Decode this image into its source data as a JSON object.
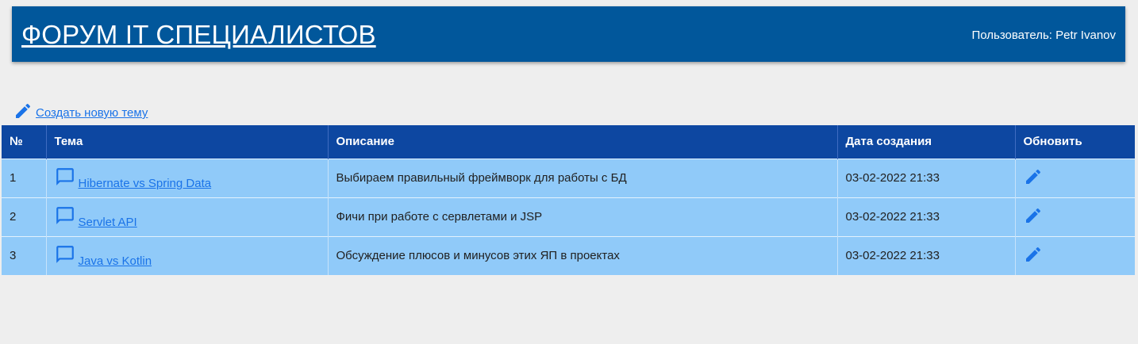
{
  "header": {
    "title": "ФОРУМ IT СПЕЦИАЛИСТОВ",
    "user_text": "Пользователь: Petr Ivanov"
  },
  "actions": {
    "create_topic_label": "Создать новую тему"
  },
  "table": {
    "columns": [
      "№",
      "Тема",
      "Описание",
      "Дата создания",
      "Обновить"
    ],
    "rows": [
      {
        "num": "1",
        "topic": "Hibernate vs Spring Data",
        "description": "Выбираем правильный фреймворк для работы с БД",
        "date": "03-02-2022 21:33"
      },
      {
        "num": "2",
        "topic": "Servlet API",
        "description": "Фичи при работе с сервлетами и JSP",
        "date": "03-02-2022 21:33"
      },
      {
        "num": "3",
        "topic": "Java vs Kotlin",
        "description": "Обсуждение плюсов и минусов этих ЯП в проектах",
        "date": "03-02-2022 21:33"
      }
    ]
  },
  "icons": {
    "create": "pencil-icon",
    "topic": "chat-bubble-icon",
    "update": "pencil-icon"
  },
  "colors": {
    "header_bg": "#01579b",
    "table_header_bg": "#0d47a1",
    "row_bg": "#90caf9",
    "link": "#1a73e8",
    "page_bg": "#eeeeee"
  }
}
